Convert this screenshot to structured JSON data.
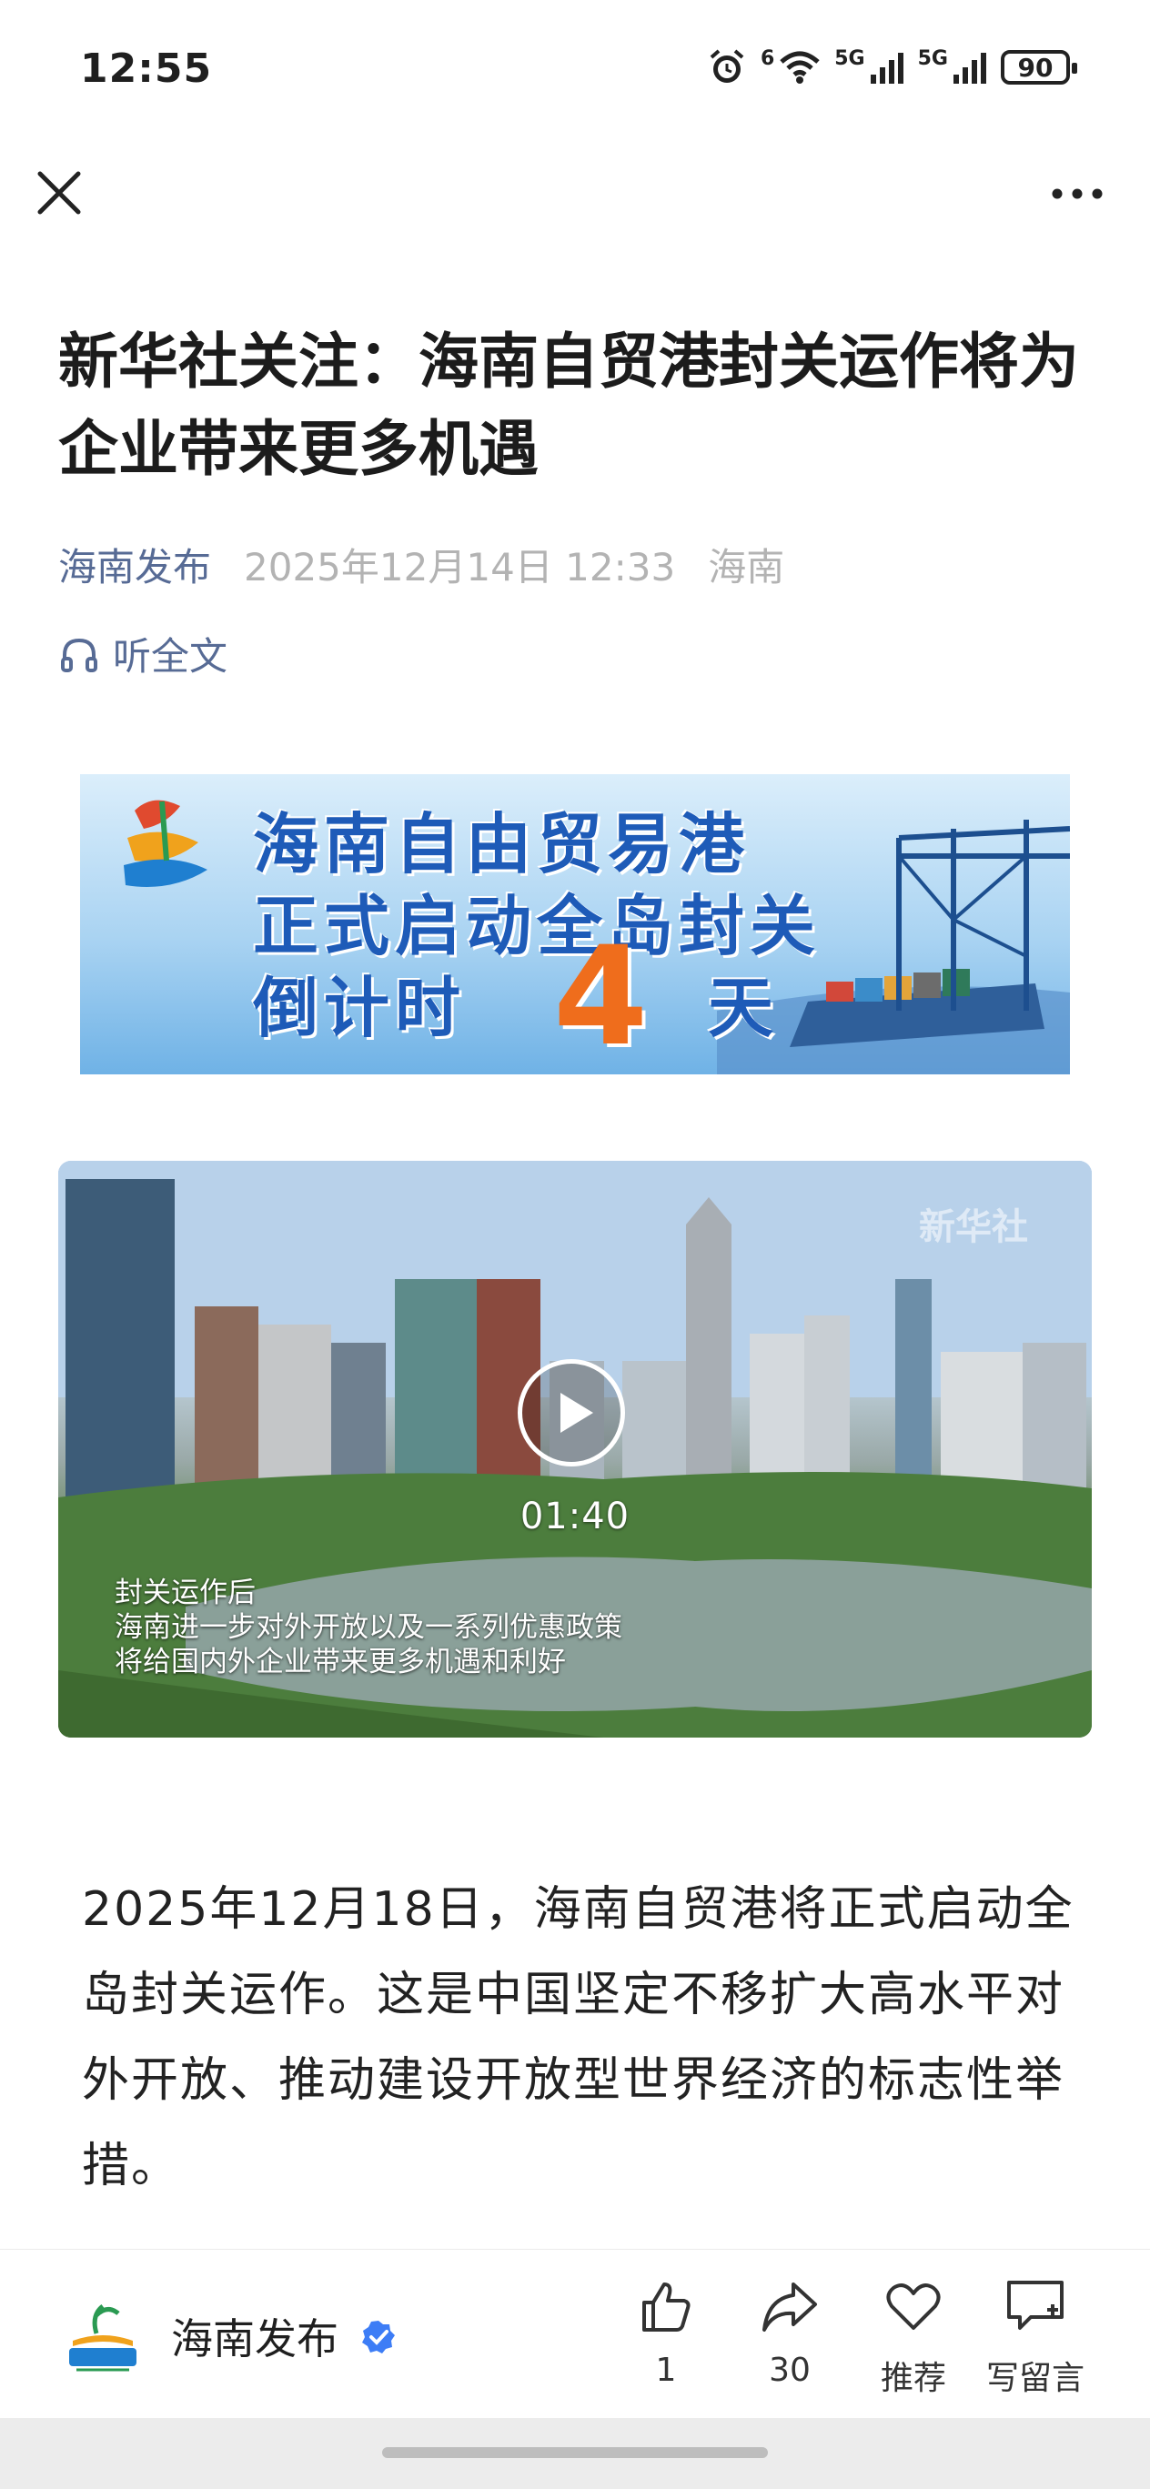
{
  "status_bar": {
    "time": "12:55",
    "battery": "90",
    "signal1": "5G",
    "signal2": "5G",
    "wifi_badge": "6"
  },
  "article": {
    "title": "新华社关注：海南自贸港封关运作将为企业带来更多机遇",
    "account": "海南发布",
    "date": "2025年12月14日 12:33",
    "location": "海南",
    "listen_label": "听全文"
  },
  "banner": {
    "line1": "海南自由贸易港",
    "line2": "正式启动全岛封关",
    "line3_prefix": "倒计时",
    "days": "4",
    "line3_suffix": "天"
  },
  "video": {
    "duration": "01:40",
    "watermark": "新华社",
    "caption_lines": [
      "封关运作后",
      "海南进一步对外开放以及一系列优惠政策",
      "将给国内外企业带来更多机遇和利好"
    ]
  },
  "body": {
    "paragraph": "2025年12月18日，海南自贸港将正式启动全岛封关运作。这是中国坚定不移扩大高水平对外开放、推动建设开放型世界经济的标志性举措。"
  },
  "bottom_bar": {
    "account_name": "海南发布",
    "like_count": "1",
    "share_count": "30",
    "recommend_label": "推荐",
    "comment_label": "写留言"
  },
  "colors": {
    "link": "#576b95",
    "meta_gray": "#b3b3b3",
    "verify": "#3d7df6",
    "banner_blue": "#1e5bb8",
    "banner_orange": "#ef6d1c"
  }
}
